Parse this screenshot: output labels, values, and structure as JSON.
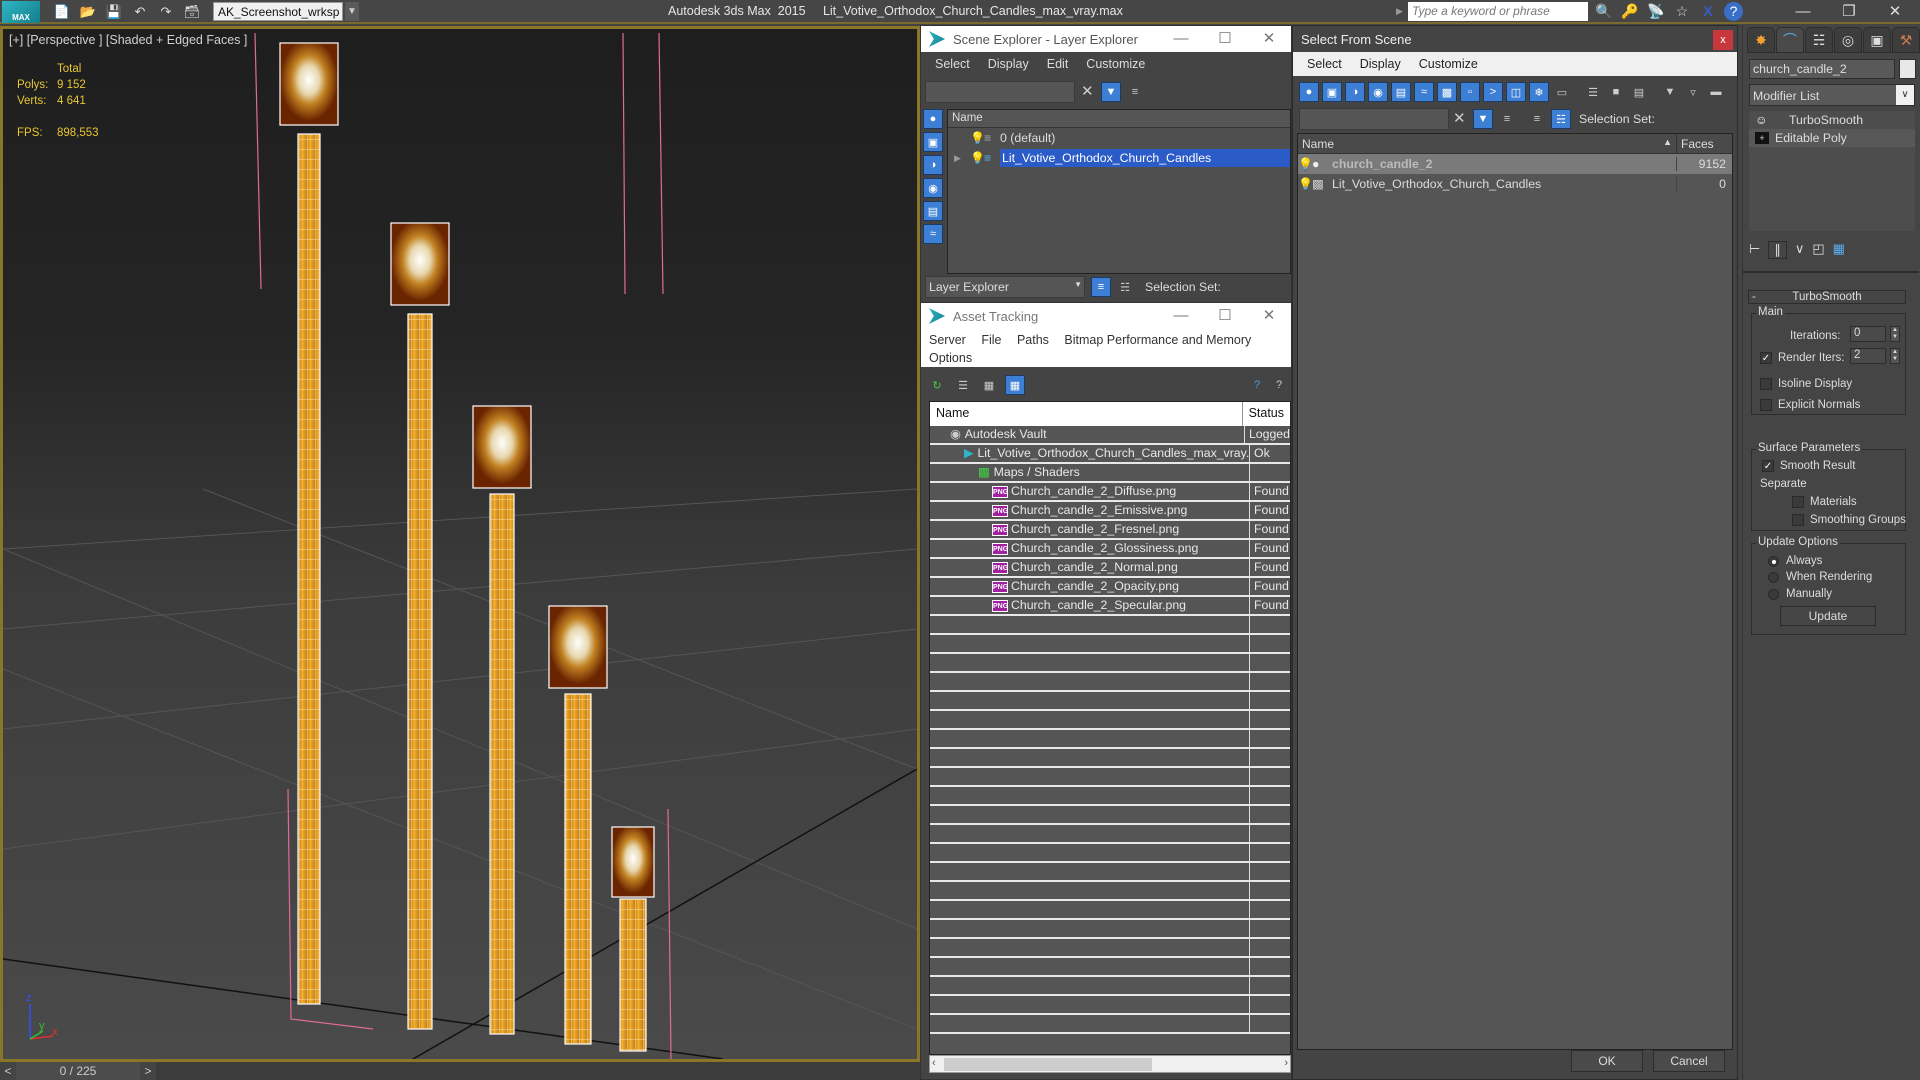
{
  "titlebar": {
    "app_badge": "MAX",
    "workspace": "AK_Screenshot_wrksp",
    "app_title": "Autodesk 3ds Max  2015     Lit_Votive_Orthodox_Church_Candles_max_vray.max",
    "search_placeholder": "Type a keyword or phrase",
    "quick_icons": [
      "new-file-icon",
      "open-folder-icon",
      "save-icon",
      "undo-icon",
      "redo-icon",
      "project-folder-icon"
    ],
    "info_icons": [
      "binoculars-icon",
      "key-icon",
      "satellite-icon",
      "star-icon",
      "x-exchange-icon",
      "help-icon"
    ]
  },
  "viewport": {
    "label": "[+] [Perspective ] [Shaded + Edged Faces ]",
    "stats": {
      "header": "Total",
      "polys_label": "Polys:",
      "polys_value": "9 152",
      "verts_label": "Verts:",
      "verts_value": "4 641",
      "fps_label": "FPS:",
      "fps_value": "898,553"
    },
    "axis_labels": {
      "x": "x",
      "y": "y",
      "z": "z"
    }
  },
  "timeline": {
    "prev": "<",
    "frame": "0 / 225",
    "next": ">"
  },
  "scene_explorer": {
    "title": "Scene Explorer - Layer Explorer",
    "menu": [
      "Select",
      "Display",
      "Edit",
      "Customize"
    ],
    "column_name": "Name",
    "layers": [
      {
        "name": "0 (default)",
        "selected": false
      },
      {
        "name": "Lit_Votive_Orthodox_Church_Candles",
        "selected": true
      }
    ],
    "footer_dropdown": "Layer Explorer",
    "selection_set_label": "Selection Set:"
  },
  "asset_tracking": {
    "title": "Asset Tracking",
    "menu": [
      "Server",
      "File",
      "Paths",
      "Bitmap Performance and Memory",
      "Options"
    ],
    "columns": [
      "Name",
      "Status"
    ],
    "rows": [
      {
        "name": "Autodesk Vault",
        "status": "Logged",
        "indent": 0,
        "icon": "vault-icon"
      },
      {
        "name": "Lit_Votive_Orthodox_Church_Candles_max_vray...",
        "status": "Ok",
        "indent": 1,
        "icon": "max-file-icon"
      },
      {
        "name": "Maps / Shaders",
        "status": "",
        "indent": 2,
        "icon": "maps-icon"
      },
      {
        "name": "Church_candle_2_Diffuse.png",
        "status": "Found",
        "indent": 3,
        "icon": "png-icon"
      },
      {
        "name": "Church_candle_2_Emissive.png",
        "status": "Found",
        "indent": 3,
        "icon": "png-icon"
      },
      {
        "name": "Church_candle_2_Fresnel.png",
        "status": "Found",
        "indent": 3,
        "icon": "png-icon"
      },
      {
        "name": "Church_candle_2_Glossiness.png",
        "status": "Found",
        "indent": 3,
        "icon": "png-icon"
      },
      {
        "name": "Church_candle_2_Normal.png",
        "status": "Found",
        "indent": 3,
        "icon": "png-icon"
      },
      {
        "name": "Church_candle_2_Opacity.png",
        "status": "Found",
        "indent": 3,
        "icon": "png-icon"
      },
      {
        "name": "Church_candle_2_Specular.png",
        "status": "Found",
        "indent": 3,
        "icon": "png-icon"
      }
    ],
    "png_badge": "PNG"
  },
  "select_from_scene": {
    "title": "Select From Scene",
    "close": "x",
    "menu": [
      "Select",
      "Display",
      "Customize"
    ],
    "selection_set_label": "Selection Set:",
    "columns": {
      "name": "Name",
      "faces": "Faces"
    },
    "rows": [
      {
        "name": "church_candle_2",
        "faces": "9152",
        "selected": true
      },
      {
        "name": "Lit_Votive_Orthodox_Church_Candles",
        "faces": "0",
        "selected": false
      }
    ],
    "ok": "OK",
    "cancel": "Cancel"
  },
  "command_panel": {
    "object_name": "church_candle_2",
    "modifier_list": "Modifier List",
    "stack": [
      "TurboSmooth",
      "Editable Poly"
    ],
    "rollout_title": "TurboSmooth",
    "main_group": "Main",
    "iterations_label": "Iterations:",
    "iterations_value": "0",
    "render_iters_label": "Render Iters:",
    "render_iters_value": "2",
    "render_iters_checked": true,
    "isoline_label": "Isoline Display",
    "explicit_normals_label": "Explicit Normals",
    "surface_group": "Surface Parameters",
    "smooth_result_label": "Smooth Result",
    "separate_label": "Separate",
    "materials_label": "Materials",
    "smoothing_groups_label": "Smoothing Groups",
    "update_group": "Update Options",
    "update_options": [
      "Always",
      "When Rendering",
      "Manually"
    ],
    "update_selected": "Always",
    "update_button": "Update"
  }
}
